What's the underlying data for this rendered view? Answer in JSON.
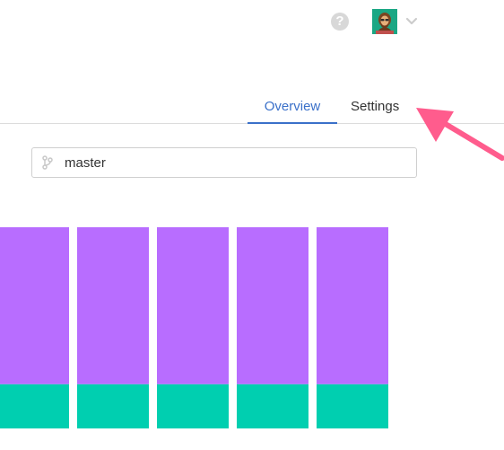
{
  "header": {
    "help_icon": "?",
    "avatar_icon": "user-avatar",
    "chevron_icon": "chevron-down-icon"
  },
  "tabs": [
    {
      "label": "Overview",
      "active": true
    },
    {
      "label": "Settings",
      "active": false
    }
  ],
  "branch": {
    "label": "master",
    "icon": "git-branch-icon"
  },
  "colors": {
    "accent_blue": "#3a70c9",
    "purple": "#b86dff",
    "teal": "#00cfb0",
    "annotation_pink": "#ff5c8d"
  },
  "chart_data": {
    "type": "bar",
    "stacked": true,
    "categories": [
      "",
      "",
      "",
      "",
      ""
    ],
    "series": [
      {
        "values": [
          22,
          22,
          22,
          22,
          22
        ],
        "color": "#00cfb0"
      },
      {
        "values": [
          78,
          78,
          78,
          78,
          78
        ],
        "color": "#b86dff"
      }
    ],
    "ylim": [
      0,
      100
    ]
  }
}
